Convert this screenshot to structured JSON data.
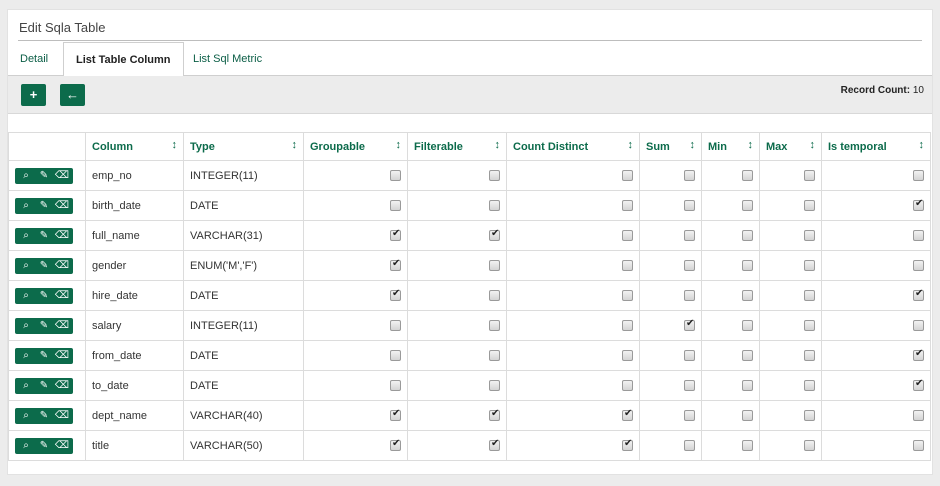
{
  "page": {
    "title": "Edit Sqla Table"
  },
  "tabs": [
    {
      "label": "Detail",
      "active": false
    },
    {
      "label": "List Table Column",
      "active": true
    },
    {
      "label": "List Sql Metric",
      "active": false
    }
  ],
  "toolbar": {
    "add_label": "+",
    "back_label": "←",
    "record_label": "Record Count:",
    "record_count": "10"
  },
  "table": {
    "columns": [
      "",
      "Column",
      "Type",
      "Groupable",
      "Filterable",
      "Count Distinct",
      "Sum",
      "Min",
      "Max",
      "Is temporal"
    ],
    "sort_icon": "↕",
    "rows": [
      {
        "column": "emp_no",
        "type": "INTEGER(11)",
        "groupable": false,
        "filterable": false,
        "count_distinct": false,
        "sum": false,
        "min": false,
        "max": false,
        "is_temporal": false
      },
      {
        "column": "birth_date",
        "type": "DATE",
        "groupable": false,
        "filterable": false,
        "count_distinct": false,
        "sum": false,
        "min": false,
        "max": false,
        "is_temporal": true
      },
      {
        "column": "full_name",
        "type": "VARCHAR(31)",
        "groupable": true,
        "filterable": true,
        "count_distinct": false,
        "sum": false,
        "min": false,
        "max": false,
        "is_temporal": false
      },
      {
        "column": "gender",
        "type": "ENUM('M','F')",
        "groupable": true,
        "filterable": false,
        "count_distinct": false,
        "sum": false,
        "min": false,
        "max": false,
        "is_temporal": false
      },
      {
        "column": "hire_date",
        "type": "DATE",
        "groupable": true,
        "filterable": false,
        "count_distinct": false,
        "sum": false,
        "min": false,
        "max": false,
        "is_temporal": true
      },
      {
        "column": "salary",
        "type": "INTEGER(11)",
        "groupable": false,
        "filterable": false,
        "count_distinct": false,
        "sum": true,
        "min": false,
        "max": false,
        "is_temporal": false
      },
      {
        "column": "from_date",
        "type": "DATE",
        "groupable": false,
        "filterable": false,
        "count_distinct": false,
        "sum": false,
        "min": false,
        "max": false,
        "is_temporal": true
      },
      {
        "column": "to_date",
        "type": "DATE",
        "groupable": false,
        "filterable": false,
        "count_distinct": false,
        "sum": false,
        "min": false,
        "max": false,
        "is_temporal": true
      },
      {
        "column": "dept_name",
        "type": "VARCHAR(40)",
        "groupable": true,
        "filterable": true,
        "count_distinct": true,
        "sum": false,
        "min": false,
        "max": false,
        "is_temporal": false
      },
      {
        "column": "title",
        "type": "VARCHAR(50)",
        "groupable": true,
        "filterable": true,
        "count_distinct": true,
        "sum": false,
        "min": false,
        "max": false,
        "is_temporal": false
      }
    ]
  },
  "row_actions": {
    "view_icon": "⌕",
    "edit_icon": "✎",
    "delete_icon": "⌫"
  }
}
